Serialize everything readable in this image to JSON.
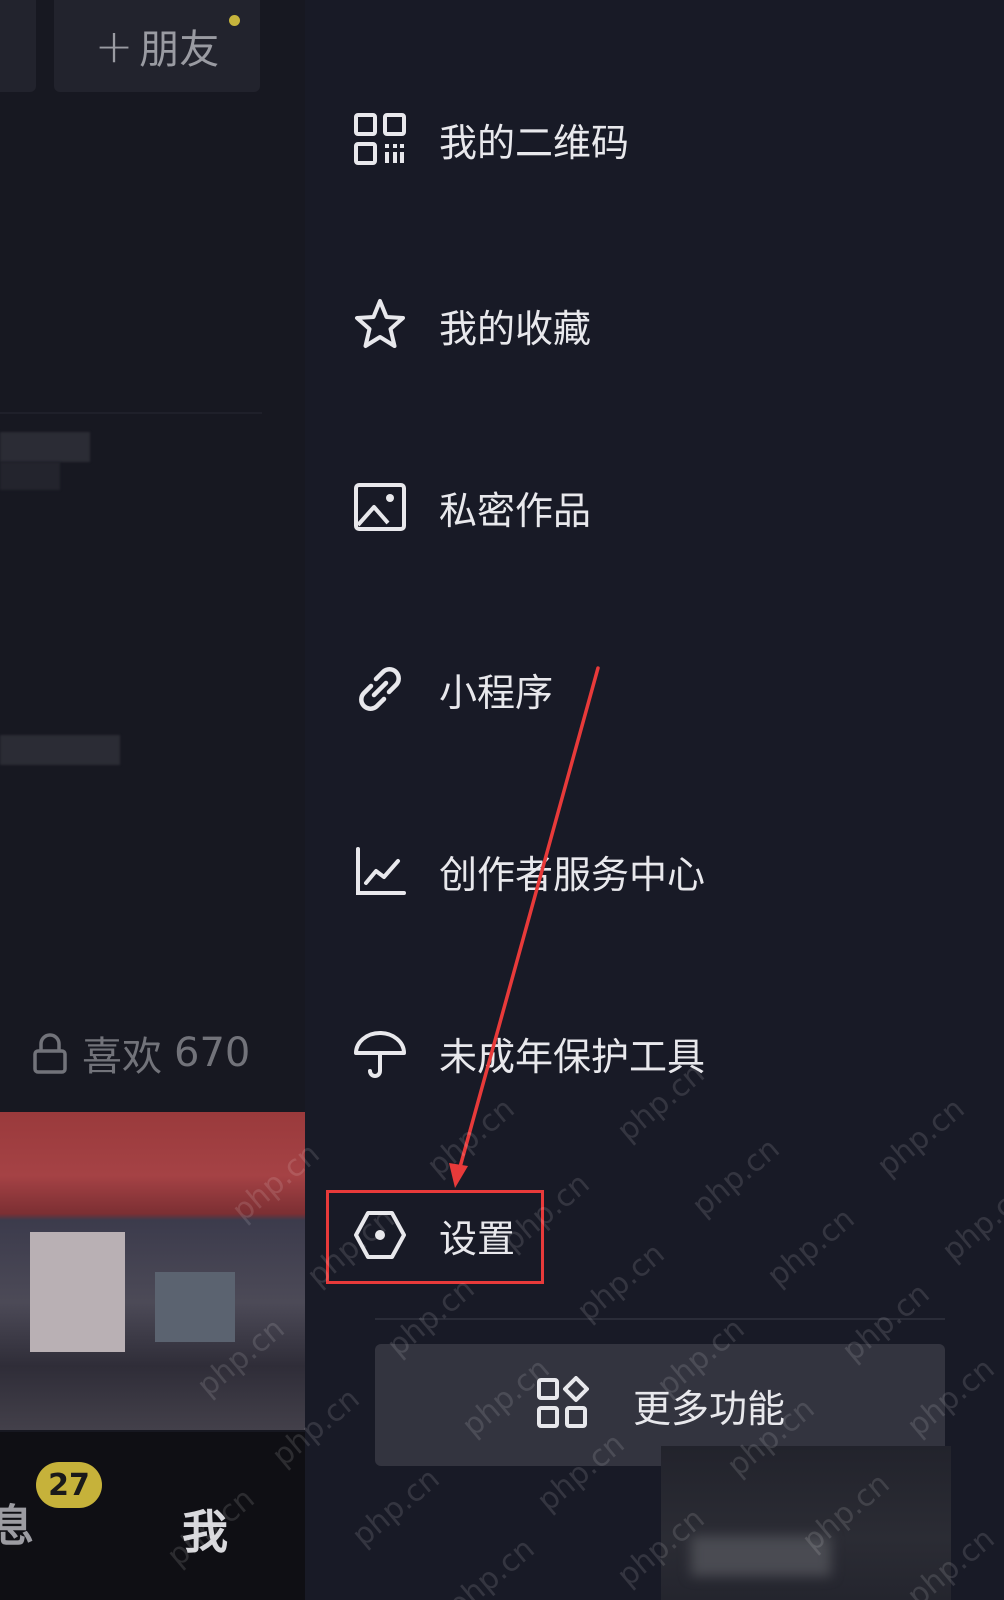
{
  "left_panel": {
    "friend_button": {
      "plus": "+",
      "label": "朋友"
    },
    "likes": {
      "label": "喜欢",
      "count": "670"
    },
    "bottom_nav": {
      "messages_partial": "息",
      "messages_badge": "27",
      "me_label": "我"
    }
  },
  "drawer": {
    "items": [
      {
        "label": "我的二维码",
        "icon": "qr-code-icon"
      },
      {
        "label": "我的收藏",
        "icon": "star-icon"
      },
      {
        "label": "私密作品",
        "icon": "private-image-icon"
      },
      {
        "label": "小程序",
        "icon": "link-icon"
      },
      {
        "label": "创作者服务中心",
        "icon": "chart-line-icon"
      },
      {
        "label": "未成年保护工具",
        "icon": "umbrella-icon"
      },
      {
        "label": "设置",
        "icon": "hexagon-settings-icon"
      }
    ],
    "more_button": {
      "label": "更多功能",
      "icon": "apps-grid-icon"
    }
  },
  "annotation": {
    "highlight_target": "设置",
    "highlight_color": "#e83a3a"
  },
  "watermark_text": "php.cn",
  "colors": {
    "background": "#181a26",
    "text": "#e8e8ec",
    "badge": "#c6b23a",
    "annotation": "#e83a3a"
  }
}
